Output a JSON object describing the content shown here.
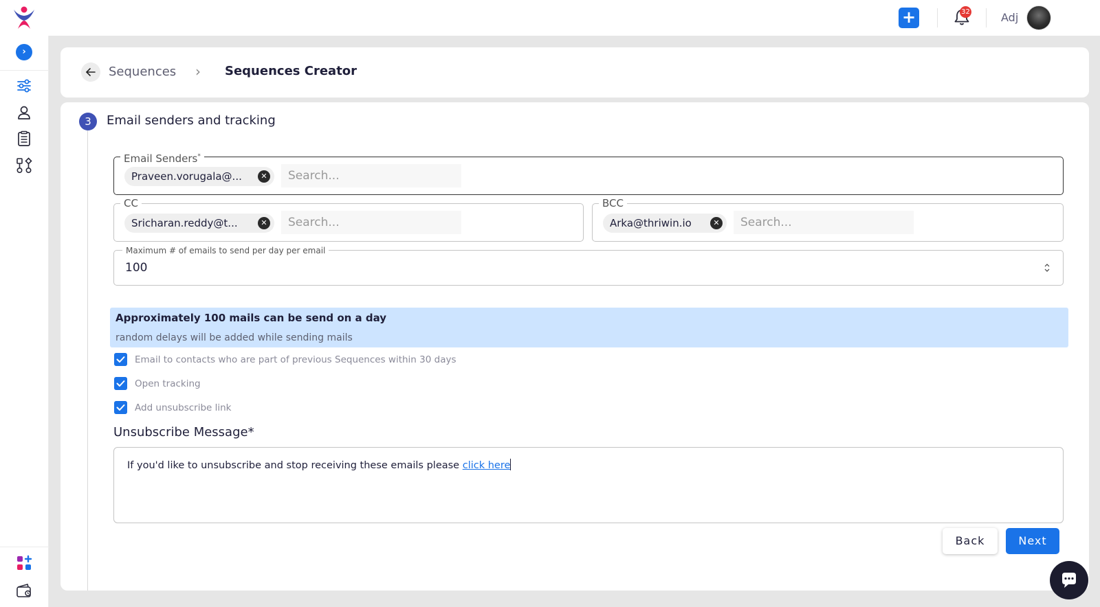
{
  "header": {
    "add_label": "+",
    "notification_count": "32",
    "user_name": "Adj"
  },
  "sidebar": {
    "expand_label": "›",
    "items": [
      {
        "icon": "sequences-icon"
      },
      {
        "icon": "contacts-icon"
      },
      {
        "icon": "tasks-icon"
      },
      {
        "icon": "workflow-icon"
      }
    ],
    "bottom_items": [
      {
        "icon": "apps-icon"
      },
      {
        "icon": "wallet-icon"
      }
    ]
  },
  "breadcrumb": {
    "back_icon": "arrow-left-icon",
    "parent": "Sequences",
    "separator": "›",
    "current": "Sequences Creator"
  },
  "step": {
    "number": "3",
    "title": "Email senders and tracking"
  },
  "email_senders": {
    "label": "Email Senders",
    "required_mark": "*",
    "chips": [
      "Praveen.vorugala@..."
    ],
    "placeholder": "Search..."
  },
  "cc": {
    "label": "CC",
    "chips": [
      "Sricharan.reddy@t..."
    ],
    "placeholder": "Search..."
  },
  "bcc": {
    "label": "BCC",
    "chips": [
      "Arka@thriwin.io"
    ],
    "placeholder": "Search..."
  },
  "max_emails": {
    "label": "Maximum # of emails to send per day per email",
    "value": "100"
  },
  "info": {
    "title": "Approximately 100 mails can be send on a day",
    "subtitle": "random delays will be added while sending mails"
  },
  "checkboxes": [
    {
      "label": "Email to contacts who are part of previous Sequences within 30 days",
      "checked": true
    },
    {
      "label": "Open tracking",
      "checked": true
    },
    {
      "label": "Add unsubscribe link",
      "checked": true
    }
  ],
  "unsubscribe": {
    "heading": "Unsubscribe Message*",
    "message": "If you'd like to unsubscribe and stop receiving these emails please ",
    "link_text": "click here"
  },
  "actions": {
    "back_label": "Back",
    "next_label": "Next"
  },
  "colors": {
    "primary": "#1a73e8",
    "step_badge": "#3f51b5",
    "info_bg": "#cde4ff",
    "notification_badge": "#e53935"
  }
}
